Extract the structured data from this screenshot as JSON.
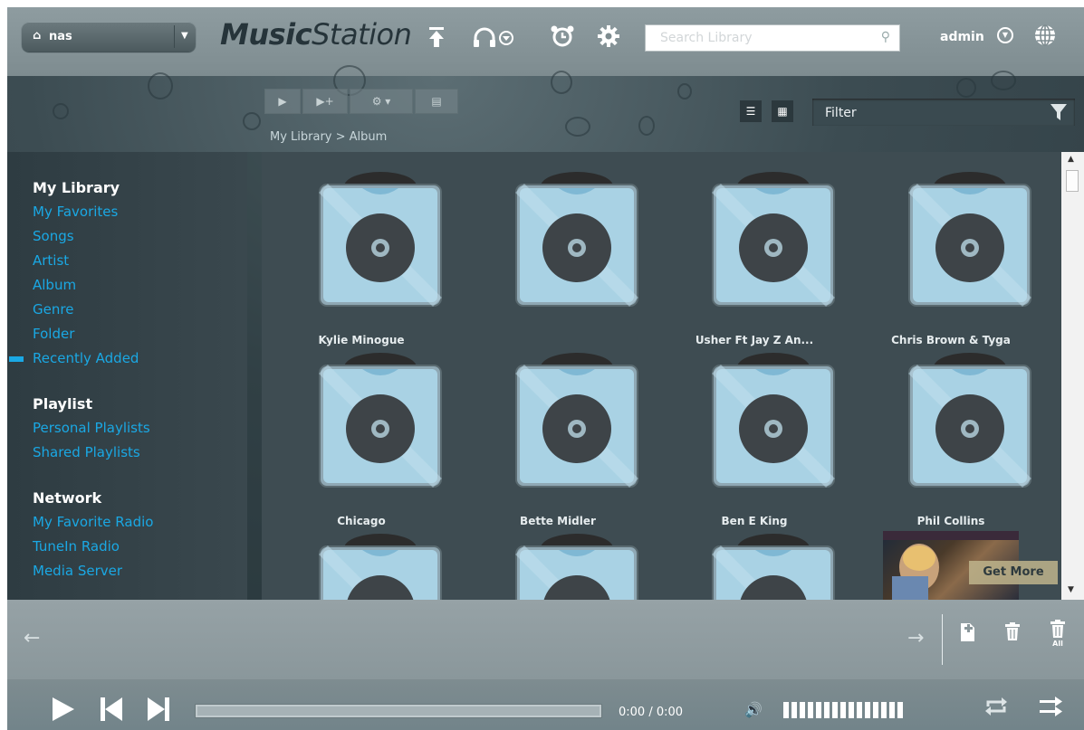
{
  "header": {
    "nas_label": "nas",
    "logo_bold": "Music",
    "logo_light": "Station",
    "search_placeholder": "Search Library",
    "user": "admin"
  },
  "toolbar": {
    "breadcrumb": "My Library > Album",
    "filter_placeholder": "Filter"
  },
  "sidebar": {
    "sections": [
      {
        "title": "My Library",
        "items": [
          "My Favorites",
          "Songs",
          "Artist",
          "Album",
          "Genre",
          "Folder",
          "Recently Added"
        ]
      },
      {
        "title": "Playlist",
        "items": [
          "Personal Playlists",
          "Shared Playlists"
        ]
      },
      {
        "title": "Network",
        "items": [
          "My Favorite Radio",
          "TuneIn Radio",
          "Media Server"
        ]
      }
    ],
    "active_item": "Album"
  },
  "albums": [
    {
      "name": "Kylie Minogue"
    },
    {
      "name": ""
    },
    {
      "name": "Usher Ft Jay Z An..."
    },
    {
      "name": "Chris Brown & Tyga"
    },
    {
      "name": "Chicago"
    },
    {
      "name": "Bette Midler"
    },
    {
      "name": "Ben E King"
    },
    {
      "name": "Phil Collins"
    }
  ],
  "promo": {
    "label": "Get More"
  },
  "player": {
    "time": "0:00 / 0:00",
    "progress": 0,
    "volume_segments": 15
  },
  "playlist_bar": {
    "delete_all_label": "All"
  },
  "colors": {
    "accent": "#1aa8e4",
    "header_bg": "#8e9ca0",
    "sidebar_bg": "#2e3c42"
  },
  "icons": [
    "home-icon",
    "upload-icon",
    "headphones-icon",
    "alarm-icon",
    "gear-icon",
    "search-icon",
    "globe-icon",
    "play-icon",
    "add-to-queue-icon",
    "settings-icon",
    "playlist-icon",
    "list-view-icon",
    "grid-view-icon",
    "filter-icon",
    "prev-arrow-icon",
    "next-arrow-icon",
    "save-playlist-icon",
    "trash-icon",
    "trash-all-icon",
    "skip-back-icon",
    "skip-forward-icon",
    "volume-icon",
    "repeat-icon",
    "shuffle-icon"
  ]
}
